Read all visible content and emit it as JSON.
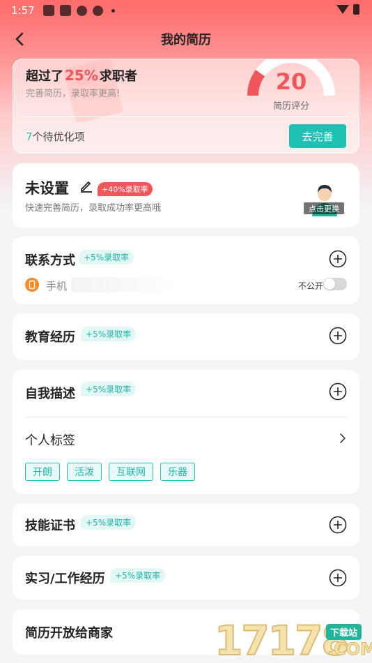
{
  "status_bar": {
    "time": "1:57"
  },
  "header": {
    "title": "我的简历"
  },
  "score_card": {
    "headline_prefix": "超过了",
    "headline_percent": "25%",
    "headline_suffix": "求职者",
    "subtitle": "完善简历，录取率更高!",
    "score": "20",
    "score_label": "简历评分",
    "score_fraction": 0.2,
    "pending_count": "7",
    "pending_text": "个待优化项",
    "complete_button": "去完善"
  },
  "profile": {
    "name": "未设置",
    "badge": "+40%录取率",
    "subtitle": "快速完善简历，录取成功率更高哦",
    "avatar_caption": "点击更换"
  },
  "contact": {
    "title": "联系方式",
    "badge": "+5%录取率",
    "phone_label": "手机",
    "private_label": "不公开",
    "private_on": false
  },
  "education": {
    "title": "教育经历",
    "badge": "+5%录取率"
  },
  "self_description": {
    "title": "自我描述",
    "badge": "+5%录取率",
    "tags_title": "个人标签",
    "tags": [
      "开朗",
      "活泼",
      "互联网",
      "乐器"
    ]
  },
  "skills": {
    "title": "技能证书",
    "badge": "+5%录取率"
  },
  "work": {
    "title": "实习/工作经历",
    "badge": "+5%录取率"
  },
  "open_to_merchants": {
    "title": "简历开放给商家"
  },
  "watermark": {
    "digits": "17178",
    "badge": "下载站",
    "suffix": ".COM"
  },
  "colors": {
    "accent": "#1fc1b5",
    "red": "#f0565a",
    "header_gradient_top": "#ff6b6b"
  }
}
